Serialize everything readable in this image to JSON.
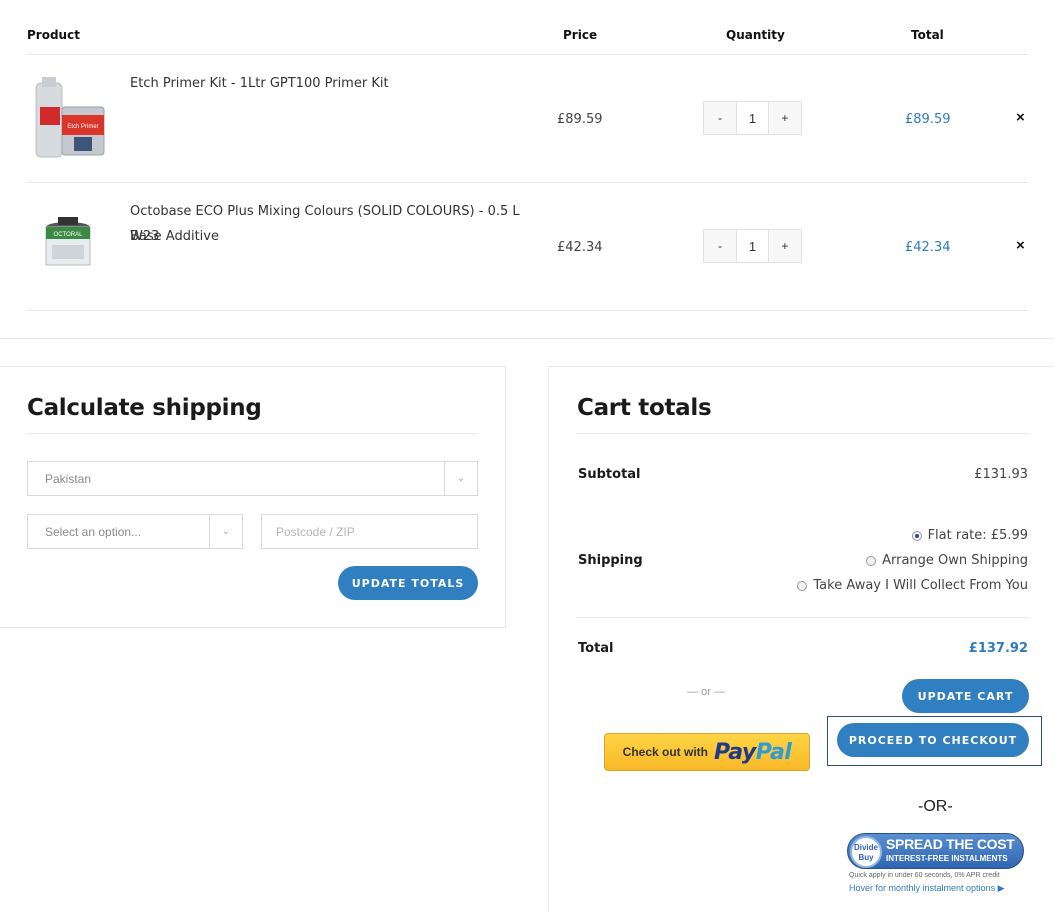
{
  "table": {
    "headers": {
      "product": "Product",
      "price": "Price",
      "quantity": "Quantity",
      "total": "Total"
    },
    "rows": [
      {
        "name_line1": "Etch Primer Kit - 1Ltr GPT100 Primer Kit",
        "name_line2": "",
        "price": "£89.59",
        "minus": "-",
        "qty": "1",
        "plus": "+",
        "total": "£89.59",
        "remove": "×",
        "image_label": "Etch Primer"
      },
      {
        "name_line1": "Octobase ECO Plus Mixing Colours (SOLID COLOURS) - 0.5 L W23",
        "name_line2": "Base Additive",
        "price": "£42.34",
        "minus": "-",
        "qty": "1",
        "plus": "+",
        "total": "£42.34",
        "remove": "×",
        "image_label": "OCTORAL"
      }
    ]
  },
  "shipping": {
    "title": "Calculate shipping",
    "country": "Pakistan",
    "state_placeholder": "Select an option...",
    "postcode_placeholder": "Postcode / ZIP",
    "update_label": "UPDATE TOTALS"
  },
  "totals": {
    "title": "Cart totals",
    "subtotal_label": "Subtotal",
    "subtotal_value": "£131.93",
    "shipping_label": "Shipping",
    "shipping_options": [
      {
        "label": "Flat rate: £5.99",
        "selected": true
      },
      {
        "label": "Arrange Own Shipping",
        "selected": false
      },
      {
        "label": "Take Away I Will Collect From You",
        "selected": false
      }
    ],
    "total_label": "Total",
    "total_value": "£137.92",
    "or_small": "— or —",
    "update_cart": "UPDATE CART",
    "checkout": "PROCEED TO CHECKOUT",
    "paypal_prefix": "Check out with",
    "paypal_pay": "Pay",
    "paypal_pal": "Pal",
    "or_big": "-OR-",
    "dividebuy": {
      "logo": "Divide Buy",
      "headline": "SPREAD THE COST",
      "subline": "INTEREST-FREE INSTALMENTS",
      "note": "Quick apply in under 60 seconds, 0% APR credit",
      "link": "Hover for monthly instalment options ▶"
    }
  },
  "colors": {
    "accent": "#2f7fc1",
    "link": "#2f7bbf",
    "paypal_yellow": "#ffc439"
  }
}
